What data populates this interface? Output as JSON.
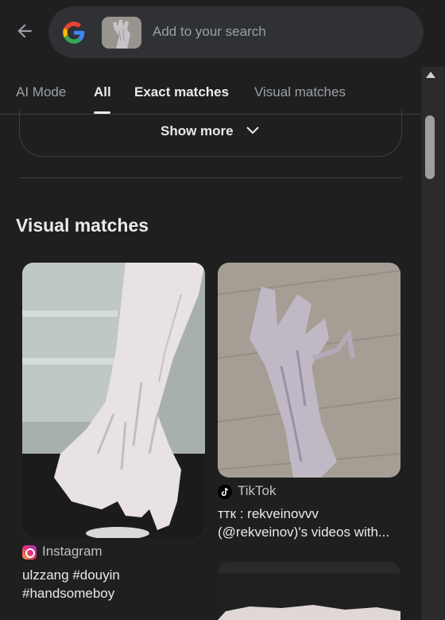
{
  "header": {
    "search_placeholder": "Add to your search",
    "query_image_icon": "veiny-hand-thumbnail"
  },
  "tabs": [
    {
      "label": "AI Mode",
      "active": false
    },
    {
      "label": "All",
      "active": true
    },
    {
      "label": "Exact matches",
      "active": false
    },
    {
      "label": "Visual matches",
      "active": false
    }
  ],
  "show_more": {
    "label": "Show more",
    "icon": "chevron-down-icon"
  },
  "section": {
    "title": "Visual matches"
  },
  "results": [
    {
      "source": "Instagram",
      "source_icon": "instagram-icon",
      "title": "ulzzang #douyin #handsomeboy",
      "image": "raised-veiny-hand"
    },
    {
      "source": "TikTok",
      "source_icon": "tiktok-icon",
      "title": "ттк : rekveinovvv (@rekveinov)'s videos with...",
      "image": "clawed-hand-on-wood"
    },
    {
      "source": "",
      "title": "",
      "image": "hand-partial"
    }
  ],
  "colors": {
    "background": "#1f1f1f",
    "search_box": "#303134",
    "text_primary": "#e8eaed",
    "text_secondary": "#9aa0a6"
  }
}
